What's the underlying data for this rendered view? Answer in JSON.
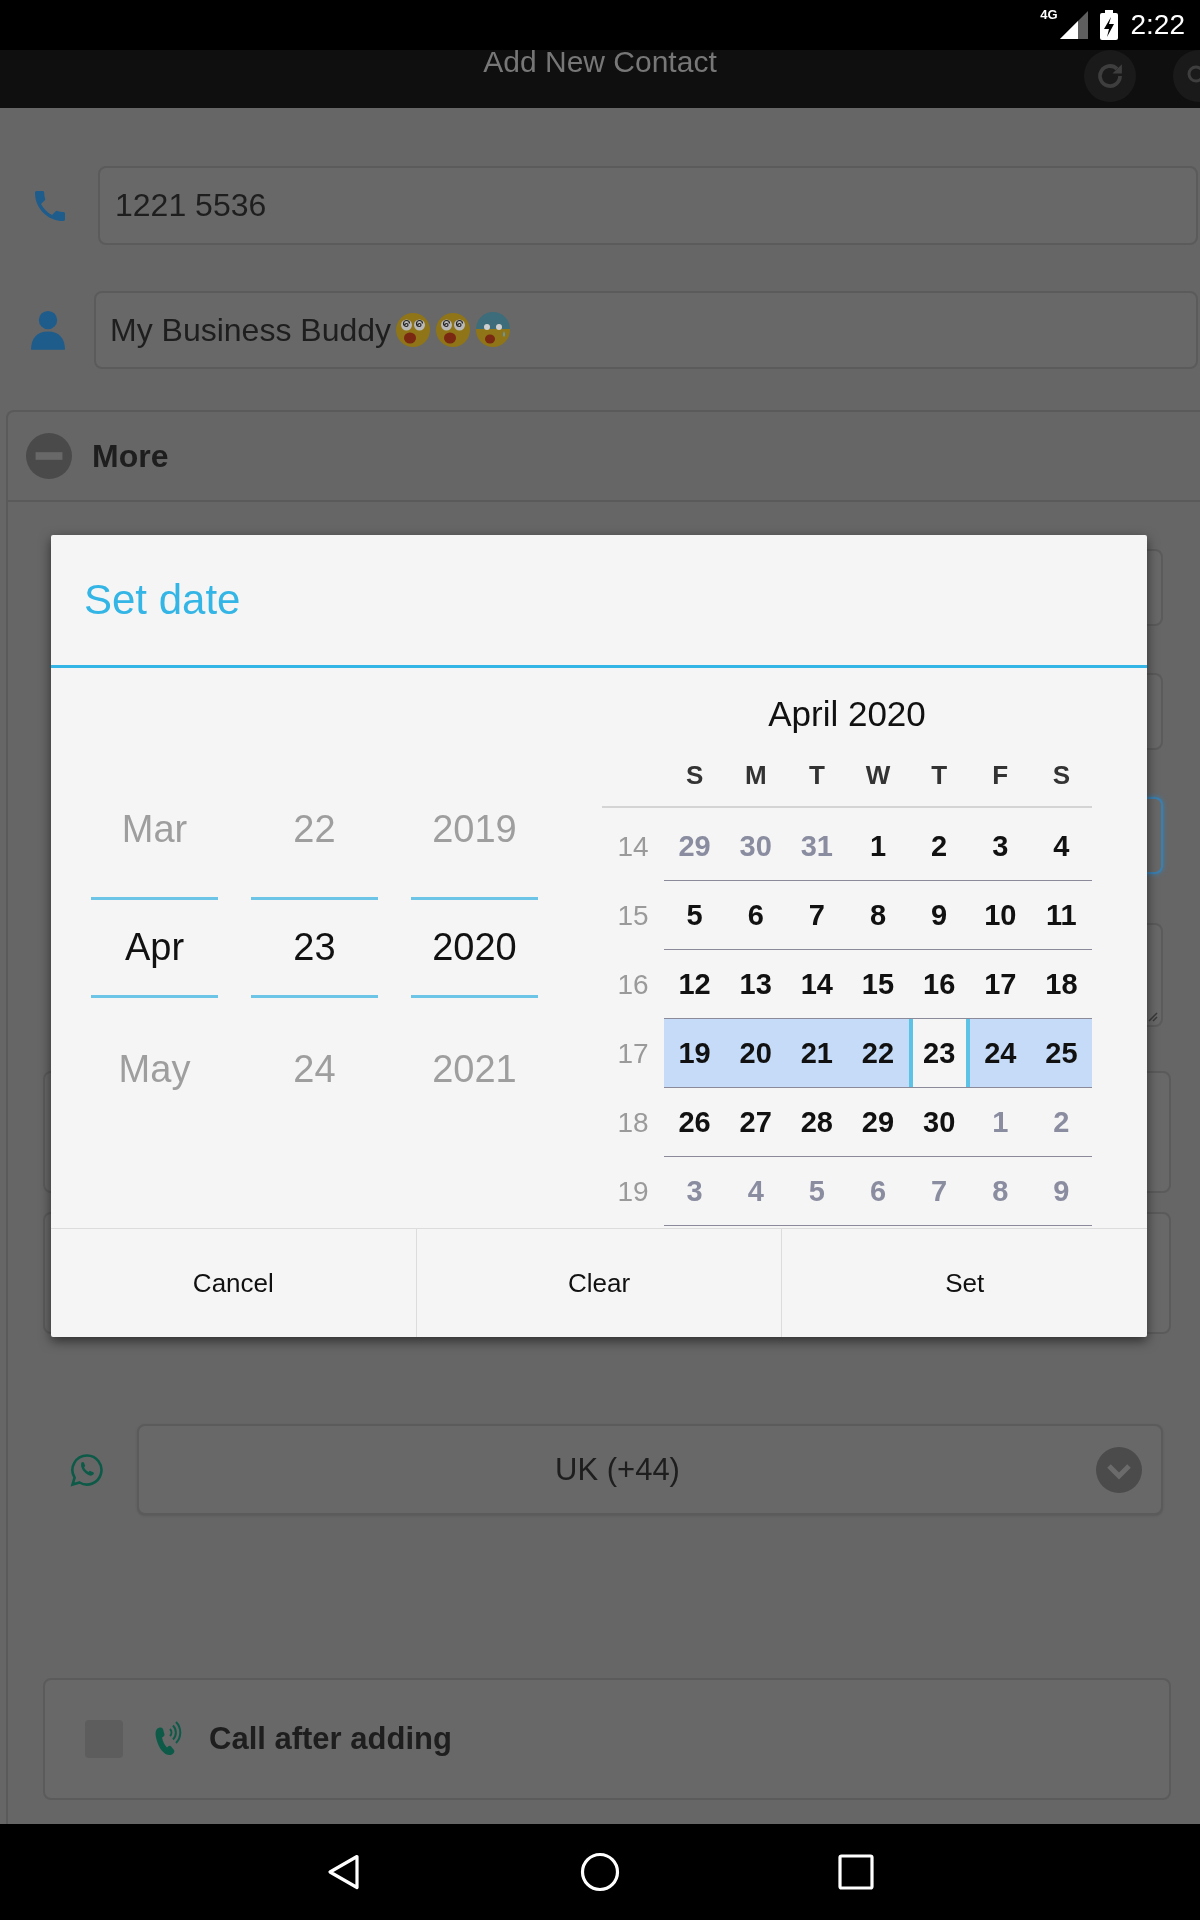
{
  "status_bar": {
    "network": "4G",
    "time": "2:22"
  },
  "app_bar": {
    "title": "Add New Contact"
  },
  "form": {
    "phone": {
      "value": "1221 5536"
    },
    "name": {
      "value": "My Business Buddy"
    },
    "more_section": {
      "label": "More",
      "expanded": true,
      "fields": [
        {
          "kind": "input",
          "focused": false
        },
        {
          "kind": "input",
          "focused": false
        },
        {
          "kind": "input",
          "focused": true
        },
        {
          "kind": "textarea",
          "focused": false
        },
        {
          "kind": "box",
          "focused": false
        },
        {
          "kind": "box",
          "focused": false
        }
      ],
      "whatsapp_country": {
        "value": "UK (+44)"
      },
      "call_after_adding": {
        "label": "Call after adding",
        "checked": false
      }
    }
  },
  "date_dialog": {
    "title": "Set date",
    "spinners": [
      {
        "previous": "Mar",
        "current": "Apr",
        "next": "May"
      },
      {
        "previous": "22",
        "current": "23",
        "next": "24"
      },
      {
        "previous": "2019",
        "current": "2020",
        "next": "2021"
      }
    ],
    "calendar": {
      "month_title": "April 2020",
      "weekdays": [
        "S",
        "M",
        "T",
        "W",
        "T",
        "F",
        "S"
      ],
      "weeks": [
        {
          "number": "14",
          "highlighted": false,
          "days": [
            {
              "label": "29",
              "in_month": false,
              "selected": false
            },
            {
              "label": "30",
              "in_month": false,
              "selected": false
            },
            {
              "label": "31",
              "in_month": false,
              "selected": false
            },
            {
              "label": "1",
              "in_month": true,
              "selected": false
            },
            {
              "label": "2",
              "in_month": true,
              "selected": false
            },
            {
              "label": "3",
              "in_month": true,
              "selected": false
            },
            {
              "label": "4",
              "in_month": true,
              "selected": false
            }
          ]
        },
        {
          "number": "15",
          "highlighted": false,
          "days": [
            {
              "label": "5",
              "in_month": true,
              "selected": false
            },
            {
              "label": "6",
              "in_month": true,
              "selected": false
            },
            {
              "label": "7",
              "in_month": true,
              "selected": false
            },
            {
              "label": "8",
              "in_month": true,
              "selected": false
            },
            {
              "label": "9",
              "in_month": true,
              "selected": false
            },
            {
              "label": "10",
              "in_month": true,
              "selected": false
            },
            {
              "label": "11",
              "in_month": true,
              "selected": false
            }
          ]
        },
        {
          "number": "16",
          "highlighted": false,
          "days": [
            {
              "label": "12",
              "in_month": true,
              "selected": false
            },
            {
              "label": "13",
              "in_month": true,
              "selected": false
            },
            {
              "label": "14",
              "in_month": true,
              "selected": false
            },
            {
              "label": "15",
              "in_month": true,
              "selected": false
            },
            {
              "label": "16",
              "in_month": true,
              "selected": false
            },
            {
              "label": "17",
              "in_month": true,
              "selected": false
            },
            {
              "label": "18",
              "in_month": true,
              "selected": false
            }
          ]
        },
        {
          "number": "17",
          "highlighted": true,
          "days": [
            {
              "label": "19",
              "in_month": true,
              "selected": false
            },
            {
              "label": "20",
              "in_month": true,
              "selected": false
            },
            {
              "label": "21",
              "in_month": true,
              "selected": false
            },
            {
              "label": "22",
              "in_month": true,
              "selected": false
            },
            {
              "label": "23",
              "in_month": true,
              "selected": true
            },
            {
              "label": "24",
              "in_month": true,
              "selected": false
            },
            {
              "label": "25",
              "in_month": true,
              "selected": false
            }
          ]
        },
        {
          "number": "18",
          "highlighted": false,
          "days": [
            {
              "label": "26",
              "in_month": true,
              "selected": false
            },
            {
              "label": "27",
              "in_month": true,
              "selected": false
            },
            {
              "label": "28",
              "in_month": true,
              "selected": false
            },
            {
              "label": "29",
              "in_month": true,
              "selected": false
            },
            {
              "label": "30",
              "in_month": true,
              "selected": false
            },
            {
              "label": "1",
              "in_month": false,
              "selected": false
            },
            {
              "label": "2",
              "in_month": false,
              "selected": false
            }
          ]
        },
        {
          "number": "19",
          "highlighted": false,
          "days": [
            {
              "label": "3",
              "in_month": false,
              "selected": false
            },
            {
              "label": "4",
              "in_month": false,
              "selected": false
            },
            {
              "label": "5",
              "in_month": false,
              "selected": false
            },
            {
              "label": "6",
              "in_month": false,
              "selected": false
            },
            {
              "label": "7",
              "in_month": false,
              "selected": false
            },
            {
              "label": "8",
              "in_month": false,
              "selected": false
            },
            {
              "label": "9",
              "in_month": false,
              "selected": false
            }
          ]
        }
      ]
    },
    "buttons": [
      "Cancel",
      "Clear",
      "Set"
    ]
  }
}
